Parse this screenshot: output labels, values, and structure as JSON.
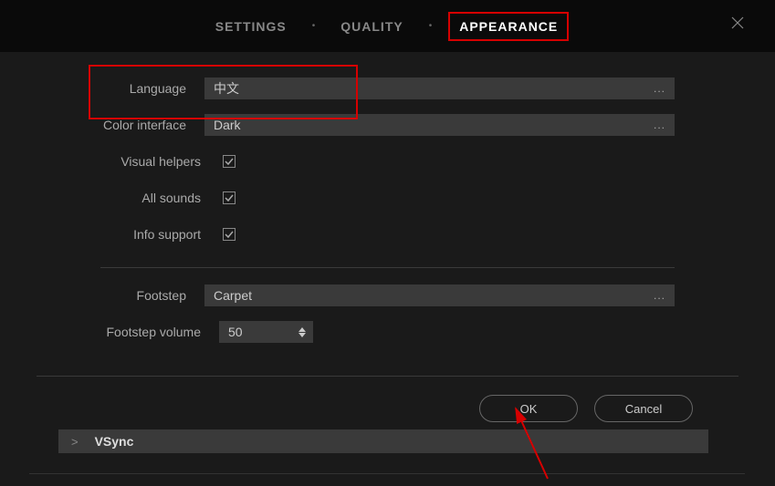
{
  "tabs": {
    "settings": "SETTINGS",
    "quality": "QUALITY",
    "appearance": "APPEARANCE"
  },
  "labels": {
    "language": "Language",
    "color_interface": "Color interface",
    "visual_helpers": "Visual helpers",
    "all_sounds": "All sounds",
    "info_support": "Info support",
    "footstep": "Footstep",
    "footstep_volume": "Footstep volume"
  },
  "values": {
    "language": "中文",
    "color_interface": "Dark",
    "footstep": "Carpet",
    "footstep_volume": "50"
  },
  "buttons": {
    "ok": "OK",
    "cancel": "Cancel"
  },
  "background": {
    "vsync": "VSync"
  },
  "dots": "..."
}
